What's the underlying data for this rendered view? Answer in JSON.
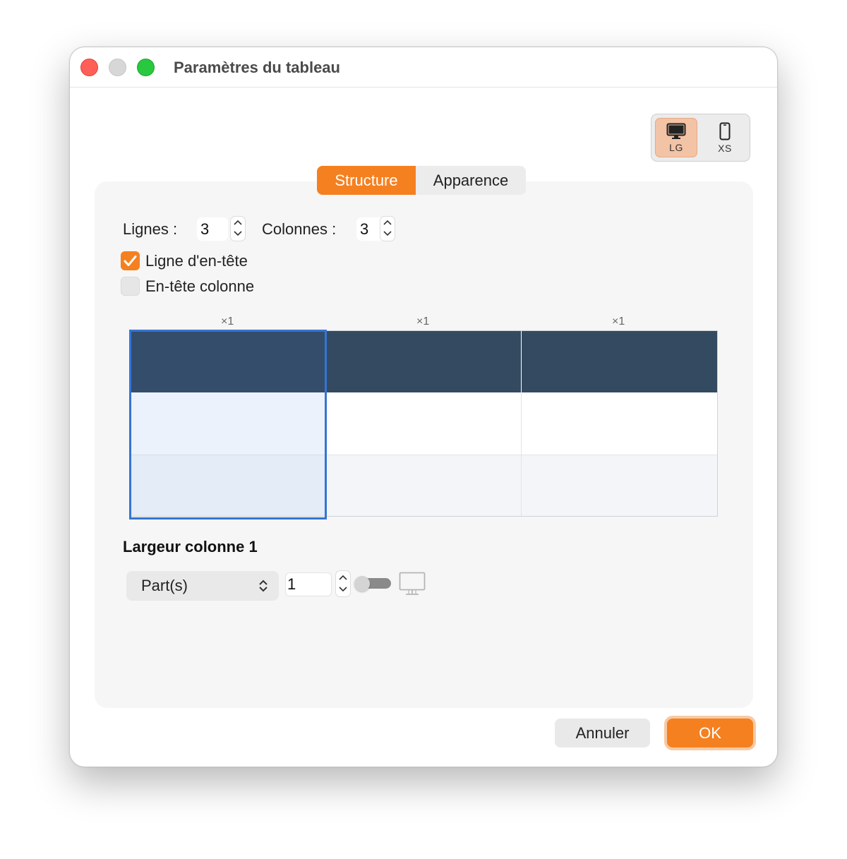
{
  "window": {
    "title": "Paramètres du tableau"
  },
  "devices": [
    {
      "id": "lg",
      "label": "LG",
      "icon": "desktop-icon",
      "selected": true
    },
    {
      "id": "xs",
      "label": "XS",
      "icon": "phone-icon",
      "selected": false
    }
  ],
  "tabs": [
    {
      "label": "Structure",
      "active": true
    },
    {
      "label": "Apparence",
      "active": false
    }
  ],
  "structure": {
    "rows_label": "Lignes :",
    "rows_value": "3",
    "cols_label": "Colonnes :",
    "cols_value": "3",
    "header_row": {
      "label": "Ligne d'en-tête",
      "checked": true
    },
    "header_col": {
      "label": "En-tête colonne",
      "checked": false
    }
  },
  "preview": {
    "multipliers": [
      "×1",
      "×1",
      "×1"
    ],
    "rows": 3,
    "cols": 3,
    "selected_col": 1,
    "header_color": "#344a60",
    "selection_color": "#3574d4"
  },
  "width": {
    "section_title": "Largeur colonne 1",
    "unit": "Part(s)",
    "value": "1",
    "toggle_on": false
  },
  "buttons": {
    "cancel": "Annuler",
    "ok": "OK"
  },
  "colors": {
    "accent": "#f5801f",
    "accent_light": "#f3c3a6"
  }
}
